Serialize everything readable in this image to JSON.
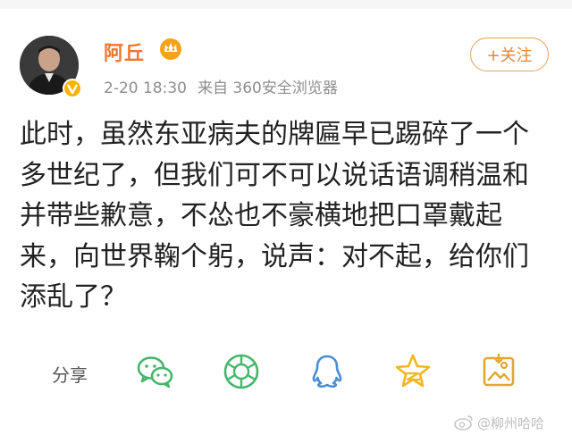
{
  "user": {
    "name": "阿丘"
  },
  "post": {
    "date": "2-20 18:30",
    "source": "来自 360安全浏览器",
    "follow_label": "+关注",
    "lines": [
      "此时，虽然东亚病夫的牌匾早已踢碎了一个",
      "多世纪了，但我们可不可以说话语调稍温和",
      "并带些歉意，不怂也不豪横地把口罩戴起",
      "来，向世界鞠个躬，说声：对不起，给你们",
      "添乱了？"
    ]
  },
  "actions": {
    "share_label": "分享",
    "icons": [
      "wechat-icon",
      "moments-icon",
      "qq-icon",
      "qzone-icon",
      "save-image-icon"
    ]
  },
  "watermark": {
    "text": "@柳州哈哈"
  },
  "colors": {
    "accent": "#f2772a",
    "icon_green": "#46b66a",
    "icon_blue": "#4a8fd6",
    "icon_yellow": "#f3b521",
    "meta_gray": "#8d8d8d"
  }
}
